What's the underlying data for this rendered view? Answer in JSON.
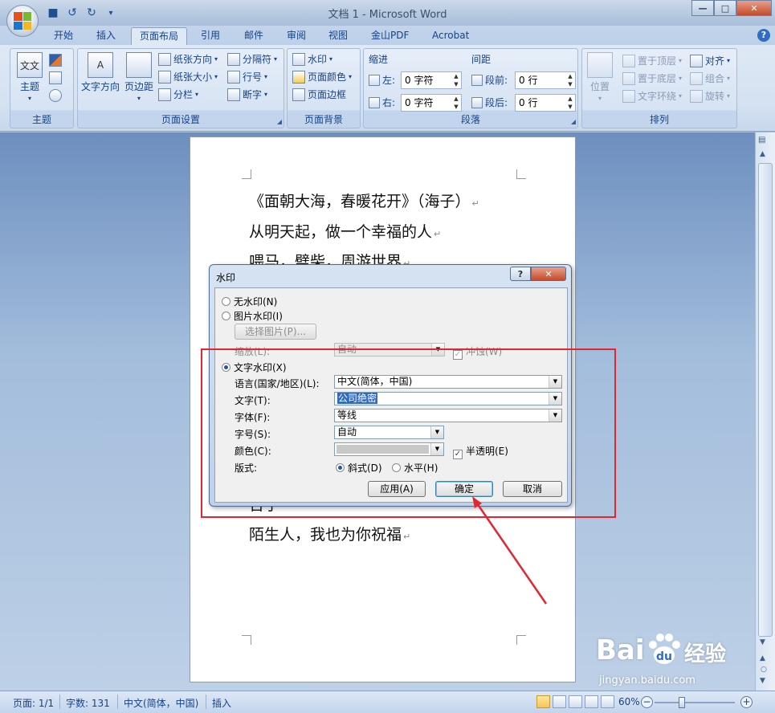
{
  "window": {
    "title": "文档 1 - Microsoft Word",
    "min_glyph": "—",
    "max_glyph": "□",
    "close_glyph": "✕"
  },
  "tabs": [
    "开始",
    "插入",
    "页面布局",
    "引用",
    "邮件",
    "审阅",
    "视图",
    "金山PDF",
    "Acrobat"
  ],
  "active_tab": "页面布局",
  "ribbon": {
    "theme_group": {
      "label": "主题",
      "theme_button": "主题",
      "theme_icon_text": "文文"
    },
    "page_setup": {
      "label": "页面设置",
      "text_direction": "文字方向",
      "margins": "页边距",
      "orientation": "纸张方向",
      "size": "纸张大小",
      "columns": "分栏",
      "breaks": "分隔符",
      "line_numbers": "行号",
      "hyphenation": "断字"
    },
    "page_background": {
      "label": "页面背景",
      "watermark": "水印",
      "page_color": "页面颜色",
      "page_borders": "页面边框"
    },
    "paragraph": {
      "label": "段落",
      "indent_title": "缩进",
      "spacing_title": "间距",
      "left_label": "左:",
      "right_label": "右:",
      "left_value": "0 字符",
      "right_value": "0 字符",
      "before_label": "段前:",
      "after_label": "段后:",
      "before_value": "0 行",
      "after_value": "0 行"
    },
    "arrange": {
      "label": "排列",
      "position": "位置",
      "bring_front": "置于顶层",
      "send_back": "置于底层",
      "text_wrap": "文字环绕",
      "align": "对齐",
      "group": "组合",
      "rotate": "旋转"
    }
  },
  "document": {
    "lines": [
      "《面朝大海，春暖花开》（海子）",
      "从明天起，做一个幸福的人",
      "喂马，劈柴，周游世界",
      "告子",
      "陌生人，我也为你祝福"
    ],
    "para_mark": "↵"
  },
  "dialog": {
    "title": "水印",
    "help": "?",
    "close": "✕",
    "no_watermark": "无水印(N)",
    "picture_watermark": "图片水印(I)",
    "select_picture": "选择图片(P)...",
    "scale_label": "缩放(L):",
    "scale_value": "自动",
    "washout_label": "冲蚀(W)",
    "text_watermark": "文字水印(X)",
    "language_label": "语言(国家/地区)(L):",
    "language_value": "中文(简体，中国)",
    "text_label": "文字(T):",
    "text_value": "公司绝密",
    "font_label": "字体(F):",
    "font_value": "等线",
    "size_label": "字号(S):",
    "size_value": "自动",
    "color_label": "颜色(C):",
    "semitransparent_label": "半透明(E)",
    "layout_label": "版式:",
    "diagonal_label": "斜式(D)",
    "horizontal_label": "水平(H)",
    "apply_button": "应用(A)",
    "ok_button": "确定",
    "cancel_button": "取消"
  },
  "statusbar": {
    "page": "页面: 1/1",
    "words": "字数: 131",
    "language": "中文(简体，中国)",
    "mode": "插入",
    "zoom": "60%",
    "zoom_percent": 60
  },
  "overlay": {
    "watermark_brand": "Bai",
    "watermark_brand2": "经验",
    "watermark_url": "jingyan.baidu.com"
  },
  "colors": {
    "annotation": "#e3262f",
    "ribbon_text": "#15428b"
  }
}
